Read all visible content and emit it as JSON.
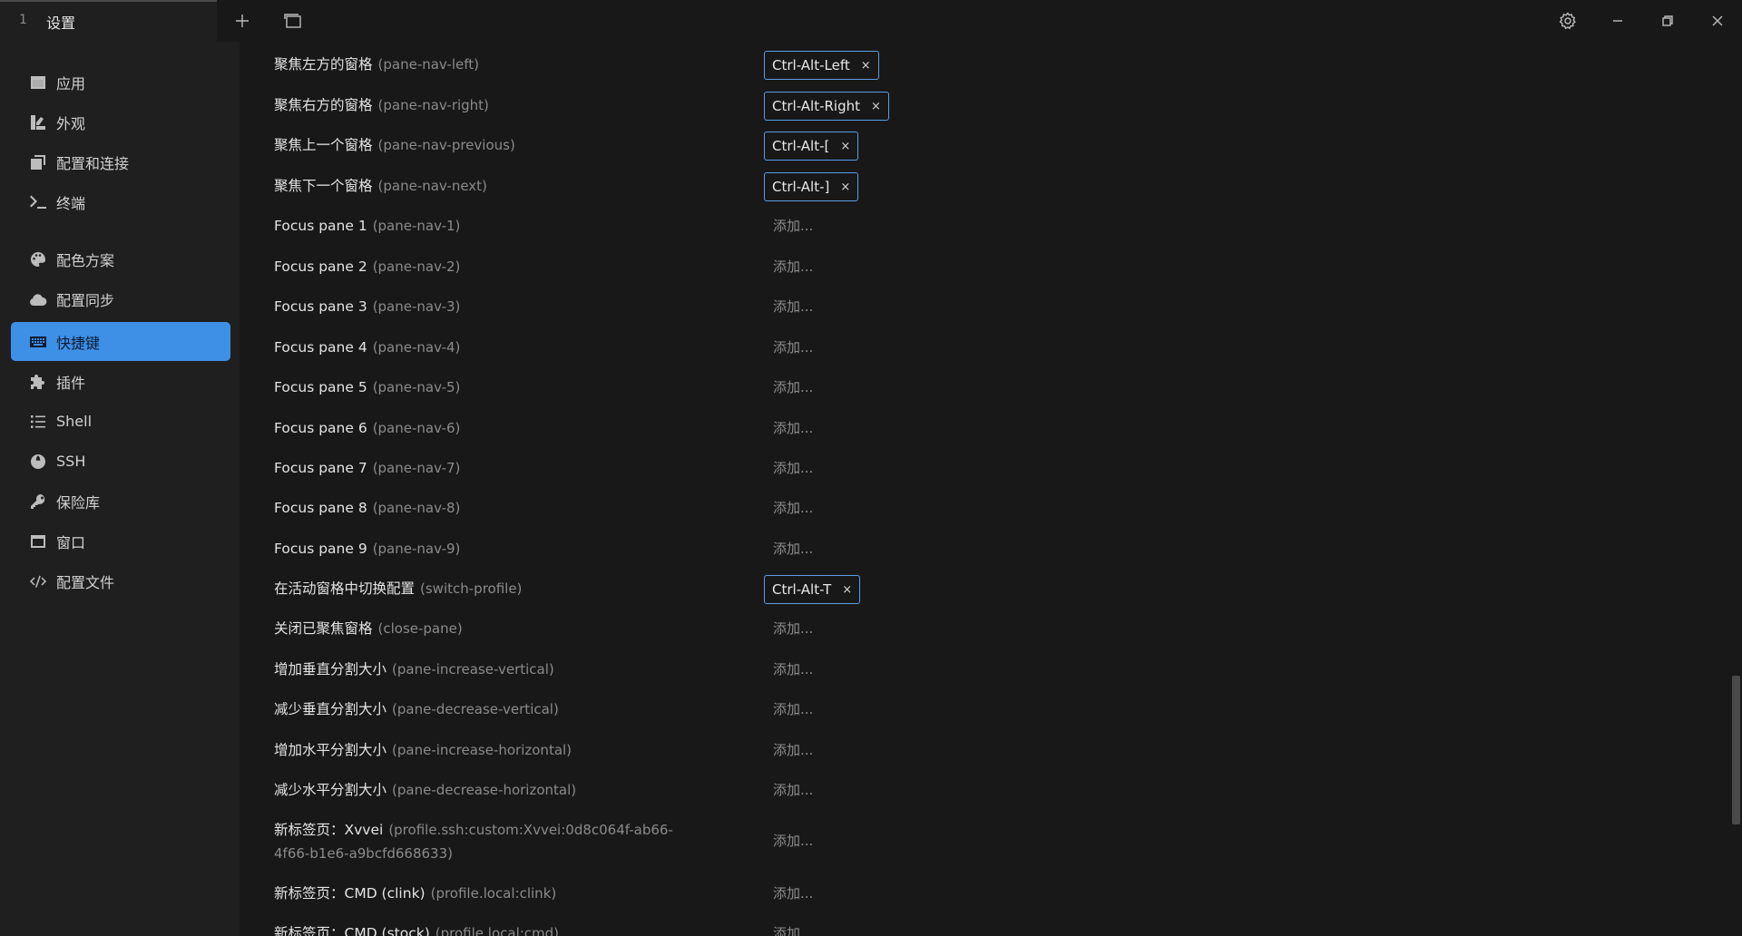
{
  "titlebar": {
    "tab_index": "1",
    "tab_title": "设置"
  },
  "sidebar": {
    "items": [
      {
        "label": "应用",
        "icon": "app-window-icon"
      },
      {
        "label": "外观",
        "icon": "paint-brush-icon"
      },
      {
        "label": "配置和连接",
        "icon": "window-stack-icon"
      },
      {
        "label": "终端",
        "icon": "terminal-prompt-icon"
      },
      {
        "label": "配色方案",
        "icon": "palette-icon"
      },
      {
        "label": "配置同步",
        "icon": "cloud-icon"
      },
      {
        "label": "快捷键",
        "icon": "keyboard-icon",
        "active": true
      },
      {
        "label": "插件",
        "icon": "puzzle-icon"
      },
      {
        "label": "Shell",
        "icon": "list-icon"
      },
      {
        "label": "SSH",
        "icon": "globe-icon"
      },
      {
        "label": "保险库",
        "icon": "key-icon"
      },
      {
        "label": "窗口",
        "icon": "window-icon"
      },
      {
        "label": "配置文件",
        "icon": "code-icon"
      }
    ]
  },
  "add_label": "添加...",
  "chip_remove": "×",
  "hotkeys": [
    {
      "title": "聚焦左方的窗格",
      "id": "(pane-nav-left)",
      "key": "Ctrl-Alt-Left"
    },
    {
      "title": "聚焦右方的窗格",
      "id": "(pane-nav-right)",
      "key": "Ctrl-Alt-Right"
    },
    {
      "title": "聚焦上一个窗格",
      "id": "(pane-nav-previous)",
      "key": "Ctrl-Alt-["
    },
    {
      "title": "聚焦下一个窗格",
      "id": "(pane-nav-next)",
      "key": "Ctrl-Alt-]"
    },
    {
      "title": "Focus pane 1",
      "id": "(pane-nav-1)",
      "key": ""
    },
    {
      "title": "Focus pane 2",
      "id": "(pane-nav-2)",
      "key": ""
    },
    {
      "title": "Focus pane 3",
      "id": "(pane-nav-3)",
      "key": ""
    },
    {
      "title": "Focus pane 4",
      "id": "(pane-nav-4)",
      "key": ""
    },
    {
      "title": "Focus pane 5",
      "id": "(pane-nav-5)",
      "key": ""
    },
    {
      "title": "Focus pane 6",
      "id": "(pane-nav-6)",
      "key": ""
    },
    {
      "title": "Focus pane 7",
      "id": "(pane-nav-7)",
      "key": ""
    },
    {
      "title": "Focus pane 8",
      "id": "(pane-nav-8)",
      "key": ""
    },
    {
      "title": "Focus pane 9",
      "id": "(pane-nav-9)",
      "key": ""
    },
    {
      "title": "在活动窗格中切换配置",
      "id": "(switch-profile)",
      "key": "Ctrl-Alt-T"
    },
    {
      "title": "关闭已聚焦窗格",
      "id": "(close-pane)",
      "key": ""
    },
    {
      "title": "增加垂直分割大小",
      "id": "(pane-increase-vertical)",
      "key": ""
    },
    {
      "title": "减少垂直分割大小",
      "id": "(pane-decrease-vertical)",
      "key": ""
    },
    {
      "title": "增加水平分割大小",
      "id": "(pane-increase-horizontal)",
      "key": ""
    },
    {
      "title": "减少水平分割大小",
      "id": "(pane-decrease-horizontal)",
      "key": ""
    },
    {
      "title": "新标签页：Xvvei",
      "id": "(profile.ssh:custom:Xvvei:0d8c064f-ab66-4f66-b1e6-a9bcfd668633)",
      "key": ""
    },
    {
      "title": "新标签页：CMD (clink)",
      "id": "(profile.local:clink)",
      "key": ""
    },
    {
      "title": "新标签页：CMD (stock)",
      "id": "(profile.local:cmd)",
      "key": ""
    }
  ]
}
